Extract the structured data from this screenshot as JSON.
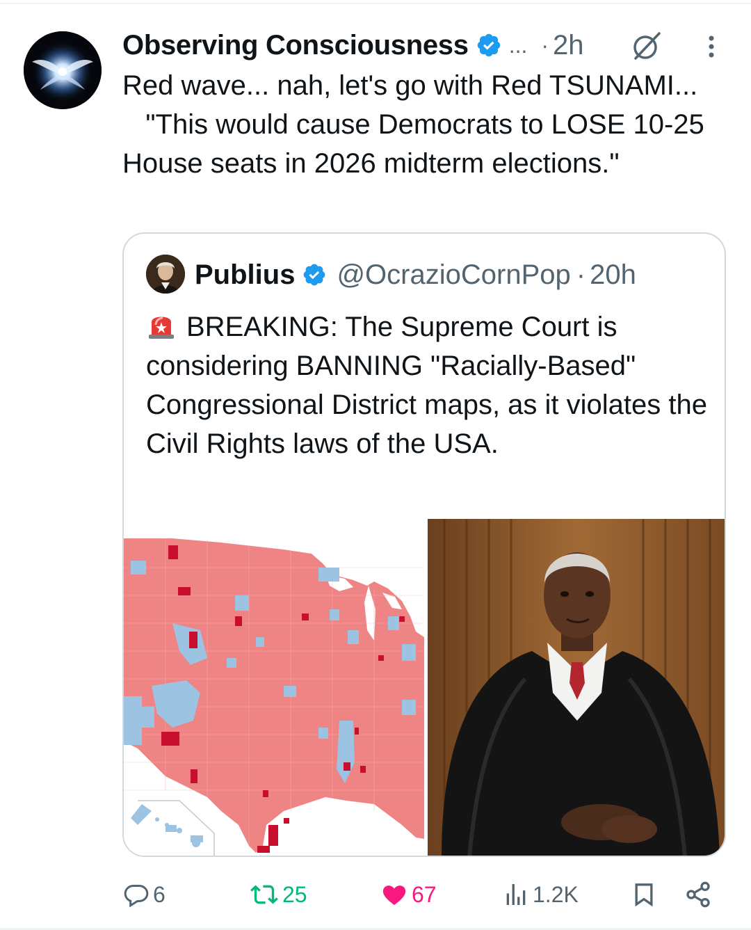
{
  "post": {
    "author": {
      "name": "Observing Consciousness",
      "verified": true,
      "avatar_icon": "glowing-angel-wings-avatar"
    },
    "ellipsis": "...",
    "separator": "·",
    "time": "2h",
    "text": "Red wave... nah, let's go with Red TSUNAMI...\n   \"This would cause Democrats to LOSE 10-25 House seats in 2026 midterm elections.\"",
    "icons": {
      "grok": "grok-icon",
      "more": "more-vertical-icon"
    }
  },
  "quoted_post": {
    "author": {
      "name": "Publius",
      "handle": "@OcrazioCornPop",
      "verified": true,
      "avatar_icon": "portrait-avatar"
    },
    "separator": "·",
    "time": "20h",
    "emoji": "siren-icon",
    "text": "BREAKING: The Supreme Court is considering BANNING \"Racially-Based\" Congressional District maps, as it violates the Civil Rights laws of the USA.",
    "more": "...",
    "images": [
      {
        "alt": "us-county-election-map"
      },
      {
        "alt": "justice-portrait"
      }
    ]
  },
  "actions": {
    "replies": "6",
    "reposts": "25",
    "likes": "67",
    "views": "1.2K"
  },
  "colors": {
    "text": "#0f1419",
    "secondary": "#536471",
    "verified": "#1d9bf0",
    "repost": "#00ba7c",
    "like": "#f91880",
    "border": "#cfd9de",
    "map_red": "#ef8484",
    "map_dark_red": "#c8102e",
    "map_blue": "#9cc3e2"
  }
}
